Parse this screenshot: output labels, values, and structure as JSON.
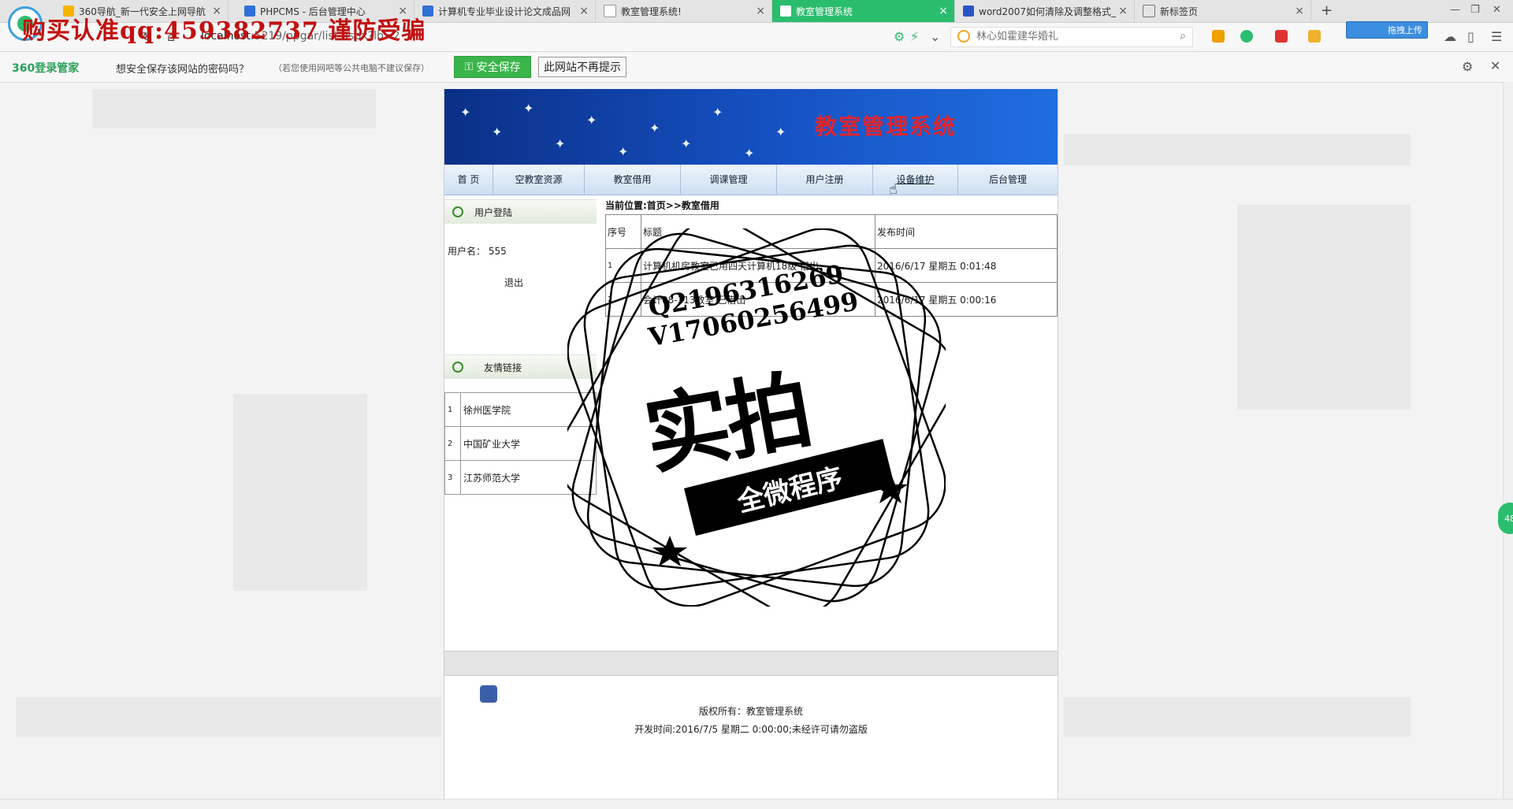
{
  "browser": {
    "tabs": [
      {
        "label": "360导航_新一代安全上网导航",
        "active": false,
        "icon_color": "#f5b400"
      },
      {
        "label": "PHPCMS - 后台管理中心",
        "active": false,
        "icon_color": "#2f6fd6"
      },
      {
        "label": "计算机专业毕业设计论文成品网",
        "active": false,
        "icon_color": "#2f6fd6"
      },
      {
        "label": "教室管理系统!",
        "active": false,
        "icon_color": "#999999"
      },
      {
        "label": "教室管理系统",
        "active": true,
        "icon_color": "#ffffff"
      },
      {
        "label": "word2007如何清除及调整格式_",
        "active": false,
        "icon_color": "#2a55c7"
      },
      {
        "label": "新标签页",
        "active": false,
        "icon_color": "#777777"
      }
    ],
    "new_tab": "+",
    "url_host": "localhost",
    "url_rest": ":5219/ppgar/list.aspx?lb=2",
    "search_placeholder": "林心如霍建华婚礼",
    "upload_label": "拖拽上传",
    "watermark": "购买认准qq:459382737 谨防受骗"
  },
  "password_bar": {
    "logo": "360登录管家",
    "question": "想安全保存该网站的密码吗？",
    "note": "（若您使用网吧等公共电脑不建议保存）",
    "save_label": "安全保存",
    "never_label": "此网站不再提示"
  },
  "site": {
    "title": "教室管理系统",
    "menu": [
      "首 页",
      "空教室资源",
      "教室借用",
      "调课管理",
      "用户注册",
      "设备维护",
      "后台管理"
    ],
    "login": {
      "header": "用户登陆",
      "username_label": "用户名：",
      "username": "555",
      "logout": "退出"
    },
    "links": {
      "header": "友情链接",
      "items": [
        {
          "num": "1",
          "name": "徐州医学院"
        },
        {
          "num": "2",
          "name": "中国矿业大学"
        },
        {
          "num": "3",
          "name": "江苏师范大学"
        }
      ]
    },
    "breadcrumb": "当前位置:首页>>教室借用",
    "table": {
      "headers": [
        "序号",
        "标题",
        "发布时间"
      ],
      "rows": [
        {
          "num": "1",
          "title": "计算机机房教室已用四天计算机18级 借出",
          "time": "2016/6/17 星期五 0:01:48"
        },
        {
          "num": "2",
          "title": "会计08-313教室 已借出",
          "time": "2016/6/17 星期五 0:00:16"
        }
      ]
    },
    "footer": {
      "copyright": "版权所有：教室管理系统",
      "dev": "开发时间:2016/7/5 星期二 0:00:00;未经许可请勿盗版"
    }
  },
  "stamp": {
    "q": "Q2196316269",
    "v": "V17060256499",
    "big": "实拍",
    "ribbon": "全微程序"
  },
  "side_float": "48"
}
